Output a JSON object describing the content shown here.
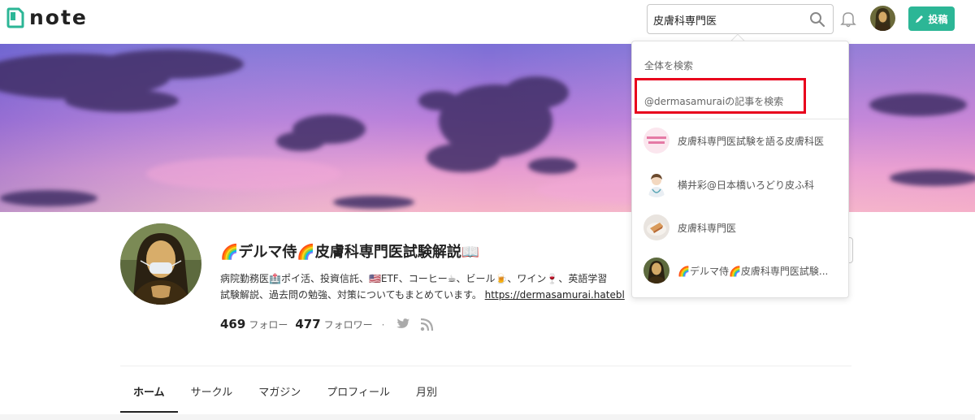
{
  "header": {
    "logo_text": "note",
    "search_value": "皮膚科専門医",
    "post_label": "投稿",
    "brand_color": "#2cb696"
  },
  "profile": {
    "name": "🌈デルマ侍🌈皮膚科専門医試験解説📖",
    "bio_line1": "病院勤務医🏥ポイ活、投資信託、🇺🇸ETF、コーヒー☕、ビール🍺、ワイン🍷、英語学習",
    "bio_line2": "試験解説、過去問の勉強、対策についてもまとめています。",
    "bio_link": "https://dermasamurai.hatebl",
    "follow_count": "469",
    "follow_label": "フォロー",
    "follower_count": "477",
    "follower_label": "フォロワー",
    "dot": "·"
  },
  "tabs": [
    {
      "label": "ホーム",
      "active": true
    },
    {
      "label": "サークル"
    },
    {
      "label": "マガジン"
    },
    {
      "label": "プロフィール"
    },
    {
      "label": "月別"
    }
  ],
  "dropdown": {
    "search_all": "全体を検索",
    "search_user": "@dermasamuraiの記事を検索",
    "highlight_color": "#e8001c",
    "results": [
      {
        "label": "皮膚科専門医試験を語る皮膚科医",
        "icon": "pink-text-avatar"
      },
      {
        "label": "横井彩@日本橋いろどり皮ふ科",
        "icon": "doctor-illustration-avatar"
      },
      {
        "label": "皮膚科専門医",
        "icon": "food-photo-avatar"
      },
      {
        "label": "🌈デルマ侍🌈皮膚科専門医試験...",
        "icon": "mona-lisa-avatar"
      }
    ]
  }
}
